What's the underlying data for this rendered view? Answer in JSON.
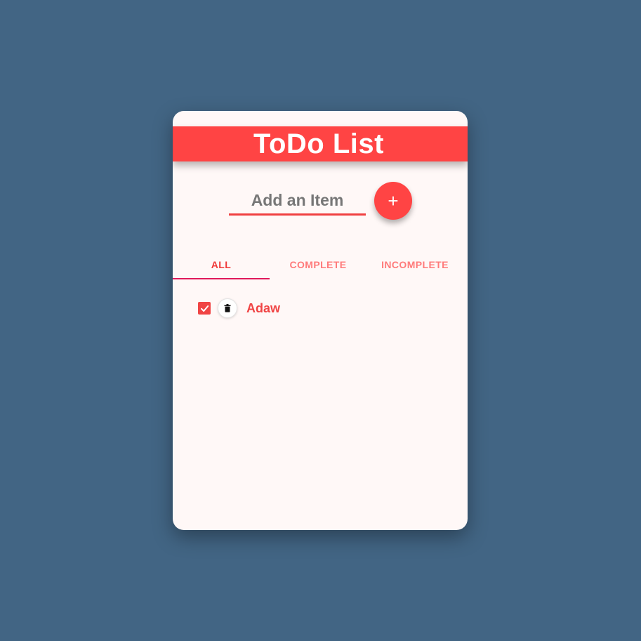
{
  "header": {
    "title": "ToDo List"
  },
  "add_form": {
    "placeholder": "Add an Item",
    "value": "",
    "add_button_label": "+"
  },
  "tabs": [
    {
      "label": "ALL",
      "active": true
    },
    {
      "label": "COMPLETE",
      "active": false
    },
    {
      "label": "INCOMPLETE",
      "active": false
    }
  ],
  "items": [
    {
      "text": "Adaw",
      "checked": true
    }
  ],
  "icons": {
    "checkbox": "check-icon",
    "delete": "trash-icon"
  },
  "colors": {
    "background": "#426584",
    "card": "#fff8f7",
    "accent": "#ff4444",
    "tab_inactive": "#ff7b7b",
    "tab_indicator": "#e0195a",
    "placeholder": "#777777"
  }
}
